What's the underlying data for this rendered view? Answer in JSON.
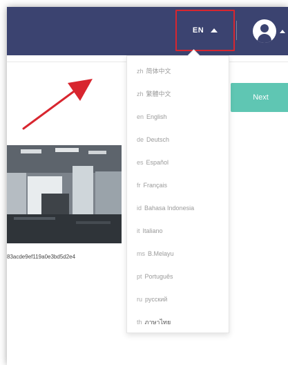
{
  "header": {
    "language_label": "EN"
  },
  "main": {
    "next_label": "Next",
    "filename": "83acde9ef119a0e3bd5d2e4"
  },
  "language_menu": {
    "items": [
      {
        "code": "zh",
        "label": "简体中文"
      },
      {
        "code": "zh",
        "label": "繁體中文"
      },
      {
        "code": "en",
        "label": "English"
      },
      {
        "code": "de",
        "label": "Deutsch"
      },
      {
        "code": "es",
        "label": "Español"
      },
      {
        "code": "fr",
        "label": "Français"
      },
      {
        "code": "id",
        "label": "Bahasa Indonesia"
      },
      {
        "code": "it",
        "label": "Italiano"
      },
      {
        "code": "ms",
        "label": "B.Melayu"
      },
      {
        "code": "pt",
        "label": "Português"
      },
      {
        "code": "ru",
        "label": "русский"
      },
      {
        "code": "th",
        "label": "ภาษาไทย"
      }
    ]
  },
  "colors": {
    "topbar": "#3b4370",
    "highlight_box": "#d8262f",
    "next_button": "#5fc6b3",
    "pointer_arrow": "#d8262f"
  }
}
